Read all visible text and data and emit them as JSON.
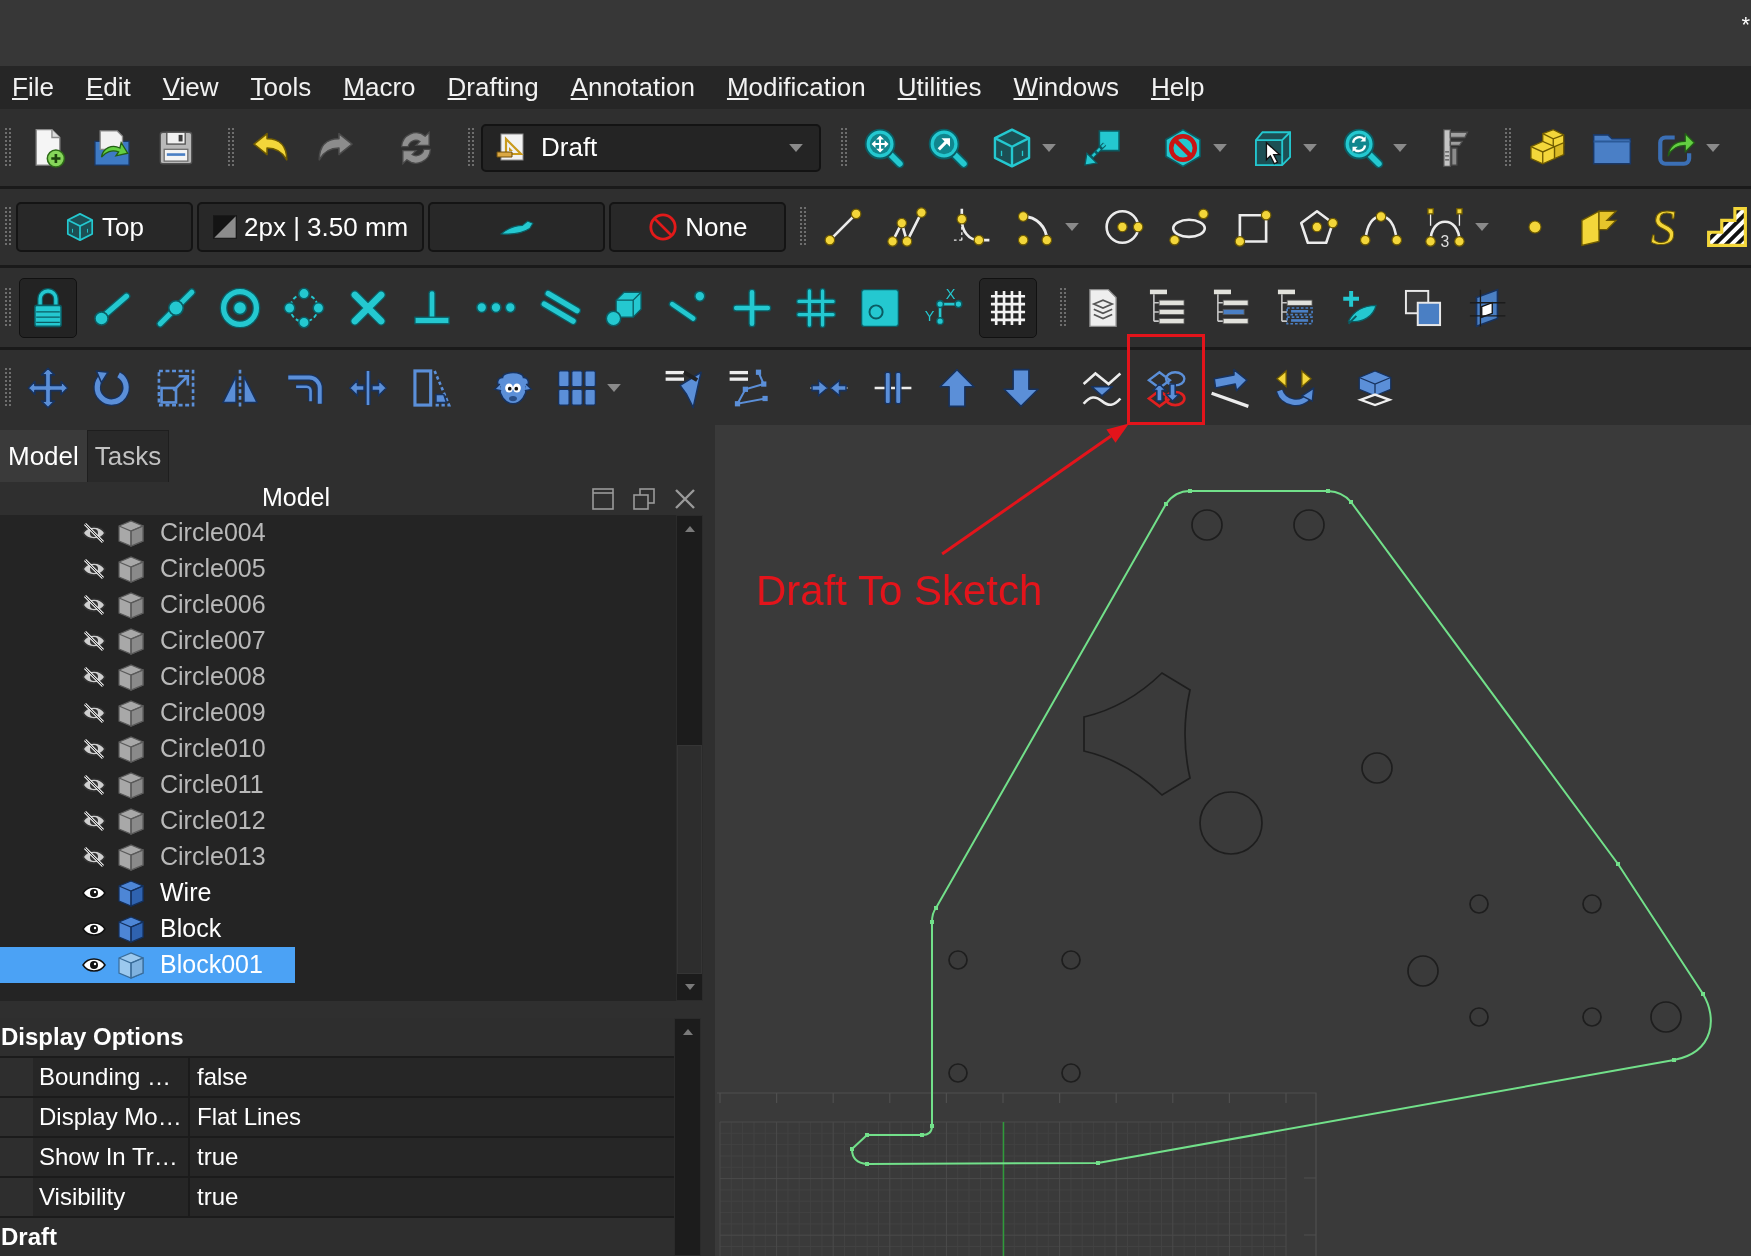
{
  "title_bar": {
    "text": "*"
  },
  "menu_bar": [
    "File",
    "Edit",
    "View",
    "Tools",
    "Macro",
    "Drafting",
    "Annotation",
    "Modification",
    "Utilities",
    "Windows",
    "Help"
  ],
  "toolbar_rows": [
    {
      "toolbars": [
        {
          "kind": "buttons",
          "groups": [
            [
              {
                "kind": "button"
              },
              {
                "kind": "button"
              },
              {
                "kind": "button"
              }
            ]
          ]
        },
        {
          "kind": "buttons",
          "groups": [
            [
              {
                "kind": "button"
              },
              {
                "kind": "button"
              }
            ],
            [
              {
                "kind": "button"
              }
            ]
          ]
        },
        {
          "kind": "workbench",
          "value": "Draft"
        },
        {
          "kind": "buttons",
          "groups": [
            [
              {
                "kind": "button"
              },
              {
                "kind": "button"
              },
              {
                "kind": "split_button"
              },
              {
                "kind": "button"
              }
            ],
            [
              {
                "kind": "split_button"
              },
              {
                "kind": "split_button"
              },
              {
                "kind": "split_button"
              },
              {
                "kind": "button"
              }
            ]
          ]
        },
        {
          "kind": "buttons",
          "groups": [
            [
              {
                "kind": "button"
              },
              {
                "kind": "button"
              },
              {
                "kind": "split_button"
              }
            ]
          ]
        }
      ]
    },
    {
      "toolbars": [
        {
          "kind": "tray",
          "buttons": [
            {
              "kind": "view",
              "label": "Top"
            },
            {
              "kind": "line_style",
              "label": "2px | 3.50 mm"
            },
            {
              "kind": "color"
            },
            {
              "kind": "text_style",
              "label": "None"
            }
          ]
        },
        {
          "kind": "buttons",
          "groups": [
            [
              {
                "kind": "button"
              },
              {
                "kind": "button"
              },
              {
                "kind": "button"
              },
              {
                "kind": "split_button"
              },
              {
                "kind": "button"
              },
              {
                "kind": "button"
              },
              {
                "kind": "button"
              },
              {
                "kind": "button"
              },
              {
                "kind": "button"
              },
              {
                "kind": "split_button",
                "glyphs": [
                  "3"
                ]
              },
              {
                "kind": "button"
              },
              {
                "kind": "button"
              },
              {
                "kind": "glyph_button",
                "glyph": "S"
              },
              {
                "kind": "button"
              }
            ]
          ]
        }
      ]
    },
    {
      "toolbars": [
        {
          "kind": "buttons",
          "groups": [
            [
              {
                "kind": "button",
                "pressed": true
              },
              {
                "kind": "button",
                "pressed": false
              },
              {
                "kind": "button",
                "pressed": false
              },
              {
                "kind": "button",
                "pressed": false
              },
              {
                "kind": "button",
                "pressed": false
              },
              {
                "kind": "button",
                "pressed": false
              },
              {
                "kind": "button",
                "pressed": false
              },
              {
                "kind": "button",
                "pressed": false
              },
              {
                "kind": "button",
                "pressed": false
              },
              {
                "kind": "button",
                "pressed": false
              },
              {
                "kind": "button",
                "pressed": false
              },
              {
                "kind": "button",
                "pressed": false
              },
              {
                "kind": "button",
                "pressed": false
              },
              {
                "kind": "button",
                "pressed": false
              },
              {
                "kind": "button",
                "pressed": false,
                "glyphs": [
                  "X",
                  "Y"
                ]
              },
              {
                "kind": "button",
                "pressed": true
              }
            ]
          ]
        },
        {
          "kind": "buttons",
          "groups": [
            [
              {
                "kind": "button"
              },
              {
                "kind": "button"
              },
              {
                "kind": "button"
              },
              {
                "kind": "button"
              },
              {
                "kind": "button"
              },
              {
                "kind": "button"
              },
              {
                "kind": "button"
              }
            ]
          ]
        }
      ]
    },
    {
      "toolbars": [
        {
          "kind": "buttons",
          "groups": [
            [
              {
                "kind": "button",
                "highlighted": false
              },
              {
                "kind": "button",
                "highlighted": false
              },
              {
                "kind": "button",
                "highlighted": false
              },
              {
                "kind": "button",
                "highlighted": false
              },
              {
                "kind": "button",
                "highlighted": false
              },
              {
                "kind": "button",
                "highlighted": false
              },
              {
                "kind": "button",
                "highlighted": false
              }
            ],
            [
              {
                "kind": "button",
                "highlighted": false
              },
              {
                "kind": "split_button",
                "highlighted": false
              }
            ],
            [
              {
                "kind": "button",
                "highlighted": false
              },
              {
                "kind": "button",
                "highlighted": false
              }
            ],
            [
              {
                "kind": "button",
                "highlighted": false
              },
              {
                "kind": "button",
                "highlighted": false
              },
              {
                "kind": "button",
                "highlighted": false
              },
              {
                "kind": "button",
                "highlighted": false
              }
            ],
            [
              {
                "kind": "button",
                "highlighted": false
              },
              {
                "kind": "button",
                "highlighted": true
              },
              {
                "kind": "button",
                "highlighted": false
              },
              {
                "kind": "button",
                "highlighted": false
              }
            ],
            [
              {
                "kind": "button",
                "highlighted": false
              }
            ]
          ]
        }
      ]
    }
  ],
  "callout": {
    "text": "Draft To Sketch"
  },
  "panel": {
    "tabs": [
      {
        "label": "Model",
        "selected": true
      },
      {
        "label": "Tasks",
        "selected": false
      }
    ],
    "title": "Model",
    "tree": [
      {
        "label": "Circle004",
        "visible": false,
        "selected": false
      },
      {
        "label": "Circle005",
        "visible": false,
        "selected": false
      },
      {
        "label": "Circle006",
        "visible": false,
        "selected": false
      },
      {
        "label": "Circle007",
        "visible": false,
        "selected": false
      },
      {
        "label": "Circle008",
        "visible": false,
        "selected": false
      },
      {
        "label": "Circle009",
        "visible": false,
        "selected": false
      },
      {
        "label": "Circle010",
        "visible": false,
        "selected": false
      },
      {
        "label": "Circle011",
        "visible": false,
        "selected": false
      },
      {
        "label": "Circle012",
        "visible": false,
        "selected": false
      },
      {
        "label": "Circle013",
        "visible": false,
        "selected": false
      },
      {
        "label": "Wire",
        "visible": true,
        "selected": false
      },
      {
        "label": "Block",
        "visible": true,
        "selected": false
      },
      {
        "label": "Block001",
        "visible": true,
        "selected": true
      }
    ],
    "property_groups": [
      {
        "name": "Display Options",
        "properties": [
          {
            "name": "Bounding …",
            "value": "false"
          },
          {
            "name": "Display Mo…",
            "value": "Flat Lines"
          },
          {
            "name": "Show In Tr…",
            "value": "true"
          },
          {
            "name": "Visibility",
            "value": "true"
          }
        ]
      },
      {
        "name": "Draft"
      }
    ]
  }
}
